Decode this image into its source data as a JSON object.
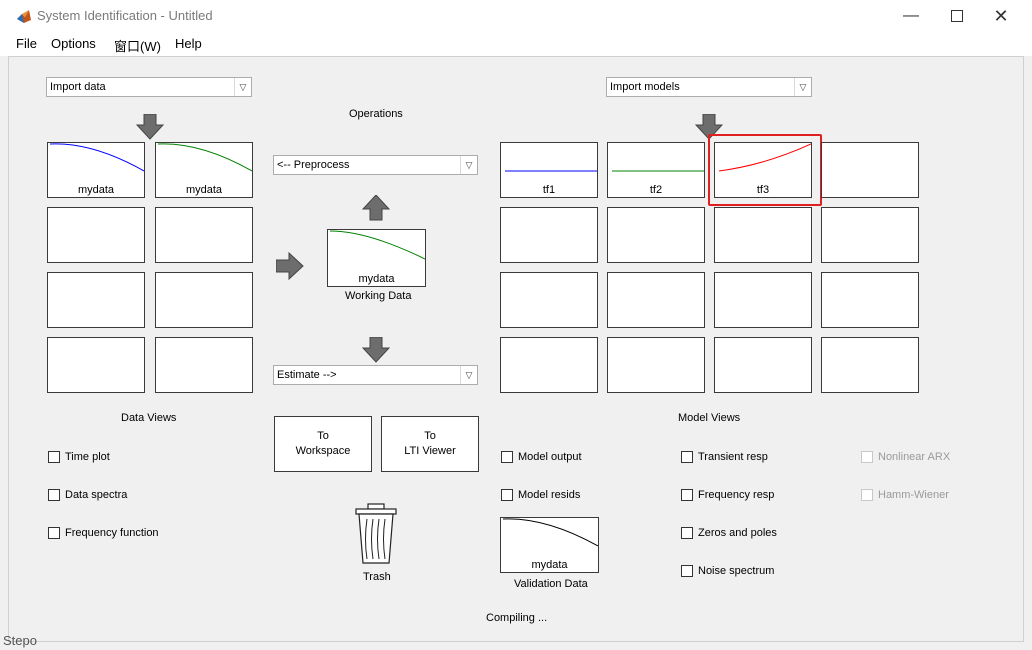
{
  "window": {
    "title": "System Identification - Untitled",
    "icon": "matlab-icon",
    "controls": [
      "minimize-icon",
      "maximize-icon",
      "close-icon"
    ]
  },
  "menu": {
    "items": [
      "File",
      "Options",
      "窗口(W)",
      "Help"
    ]
  },
  "import_data": {
    "selected": "Import data"
  },
  "import_models": {
    "selected": "Import models"
  },
  "operations": {
    "label": "Operations",
    "preprocess": "<-- Preprocess",
    "estimate": "Estimate -->"
  },
  "data_tiles": [
    {
      "label": "mydata",
      "color": "#0000ff"
    },
    {
      "label": "mydata",
      "color": "#008000"
    },
    {
      "label": ""
    },
    {
      "label": ""
    },
    {
      "label": ""
    },
    {
      "label": ""
    },
    {
      "label": ""
    },
    {
      "label": ""
    }
  ],
  "working_data": {
    "name": "mydata",
    "label": "Working Data",
    "color": "#008000"
  },
  "model_tiles": [
    {
      "label": "tf1",
      "color": "#0000ff"
    },
    {
      "label": "tf2",
      "color": "#008000"
    },
    {
      "label": "tf3",
      "color": "#ff0000",
      "highlighted": true
    },
    {
      "label": ""
    }
  ],
  "data_views": {
    "title": "Data Views",
    "items": [
      "Time plot",
      "Data spectra",
      "Frequency function"
    ]
  },
  "buttons": {
    "to_workspace": [
      "To",
      "Workspace"
    ],
    "to_lti_viewer": [
      "To",
      "LTI Viewer"
    ]
  },
  "trash": {
    "label": "Trash"
  },
  "model_views": {
    "title": "Model Views",
    "col1": [
      "Model output",
      "Model resids"
    ],
    "col2": [
      "Transient resp",
      "Frequency resp",
      "Zeros and poles",
      "Noise spectrum"
    ],
    "col3": [
      "Nonlinear ARX",
      "Hamm-Wiener"
    ]
  },
  "validation_data": {
    "name": "mydata",
    "label": "Validation Data"
  },
  "status": "Compiling ...",
  "background_text": {
    "bottom_left": "Stepo"
  }
}
